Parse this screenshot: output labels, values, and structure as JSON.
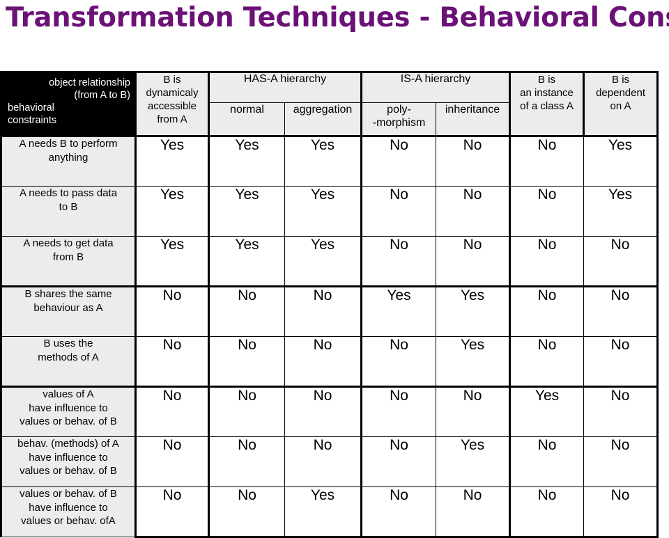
{
  "slide": {
    "title": "Transformation Techniques - Behavioral Constraints",
    "title_color": "#6B1177",
    "background_color": "#FFFFFF"
  },
  "table": {
    "corner": {
      "line1": "object relationship",
      "line2": "(from  A to B)",
      "line3": "behavioral",
      "line4": "constraints",
      "background_color": "#000000",
      "text_color": "#FFFFFF"
    },
    "header": {
      "col_dynamic": {
        "line1": "B is",
        "line2": "dynamicaly",
        "line3": "accessible",
        "line4": "from A"
      },
      "group_has_a": "HAS-A hierarchy",
      "group_is_a": "IS-A hierarchy",
      "sub_normal": "normal",
      "sub_aggregation": "aggregation",
      "sub_polymorphism_line1": "poly-",
      "sub_polymorphism_line2": "-morphism",
      "sub_inheritance": "inheritance",
      "col_instance": {
        "line1": "B is",
        "line2": "an instance",
        "line3": "of a class A"
      },
      "col_dependent": {
        "line1": "B is",
        "line2": "dependent",
        "line3": "on A"
      },
      "background_color": "#ECECEC"
    },
    "column_keys": [
      "B is dynamicaly accessible from A",
      "normal",
      "aggregation",
      "poly--morphism",
      "inheritance",
      "B is an instance of a class A",
      "B is dependent on A"
    ],
    "rows": [
      {
        "label_lines": [
          "A needs B to perform",
          "anything"
        ],
        "values": [
          "Yes",
          "Yes",
          "Yes",
          "No",
          "No",
          "No",
          "Yes"
        ]
      },
      {
        "label_lines": [
          "A needs to pass data",
          "to B"
        ],
        "values": [
          "Yes",
          "Yes",
          "Yes",
          "No",
          "No",
          "No",
          "Yes"
        ]
      },
      {
        "label_lines": [
          "A needs to get data",
          "from B"
        ],
        "values": [
          "Yes",
          "Yes",
          "Yes",
          "No",
          "No",
          "No",
          "No"
        ]
      },
      {
        "label_lines": [
          "B shares the same",
          "behaviour as A"
        ],
        "values": [
          "No",
          "No",
          "No",
          "Yes",
          "Yes",
          "No",
          "No"
        ]
      },
      {
        "label_lines": [
          "B uses the",
          "methods of A"
        ],
        "values": [
          "No",
          "No",
          "No",
          "No",
          "Yes",
          "No",
          "No"
        ]
      },
      {
        "label_lines": [
          "values  of A",
          "have influence to",
          "values or behav. of B"
        ],
        "values": [
          "No",
          "No",
          "No",
          "No",
          "No",
          "Yes",
          "No"
        ]
      },
      {
        "label_lines": [
          "behav. (methods) of A",
          "have influence to",
          "values or behav. of B"
        ],
        "values": [
          "No",
          "No",
          "No",
          "No",
          "Yes",
          "No",
          "No"
        ]
      },
      {
        "label_lines": [
          "values or behav. of B",
          "have influence to",
          "values or behav. ofA"
        ],
        "values": [
          "No",
          "No",
          "Yes",
          "No",
          "No",
          "No",
          "No"
        ]
      }
    ]
  }
}
